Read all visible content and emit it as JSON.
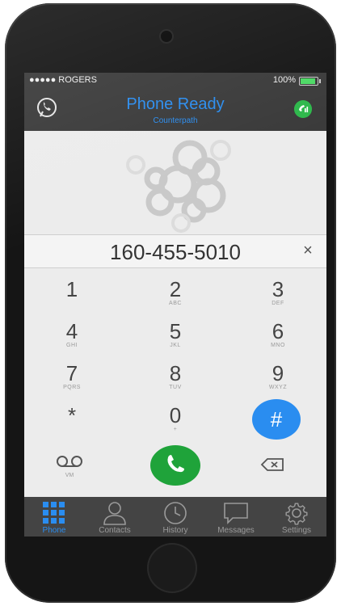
{
  "status_bar": {
    "carrier": "●●●●● ROGERS",
    "battery": "100%"
  },
  "header": {
    "title": "Phone Ready",
    "subtitle": "Counterpath"
  },
  "dialer": {
    "number": "160-455-5010",
    "clear": "×"
  },
  "keypad": [
    {
      "digit": "1",
      "letters": ""
    },
    {
      "digit": "2",
      "letters": "ABC"
    },
    {
      "digit": "3",
      "letters": "DEF"
    },
    {
      "digit": "4",
      "letters": "GHI"
    },
    {
      "digit": "5",
      "letters": "JKL"
    },
    {
      "digit": "6",
      "letters": "MNO"
    },
    {
      "digit": "7",
      "letters": "PQRS"
    },
    {
      "digit": "8",
      "letters": "TUV"
    },
    {
      "digit": "9",
      "letters": "WXYZ"
    },
    {
      "digit": "*",
      "letters": ""
    },
    {
      "digit": "0",
      "letters": "+"
    },
    {
      "digit": "#",
      "letters": ""
    }
  ],
  "voicemail_label": "VM",
  "tabs": [
    {
      "label": "Phone",
      "icon": "keypad-grid-icon",
      "active": true
    },
    {
      "label": "Contacts",
      "icon": "person-icon",
      "active": false
    },
    {
      "label": "History",
      "icon": "clock-icon",
      "active": false
    },
    {
      "label": "Messages",
      "icon": "speech-bubble-icon",
      "active": false
    },
    {
      "label": "Settings",
      "icon": "gear-icon",
      "active": false
    }
  ],
  "colors": {
    "accent": "#2a8df0",
    "call_green": "#1fa33a",
    "bar": "#3a3a3a"
  }
}
